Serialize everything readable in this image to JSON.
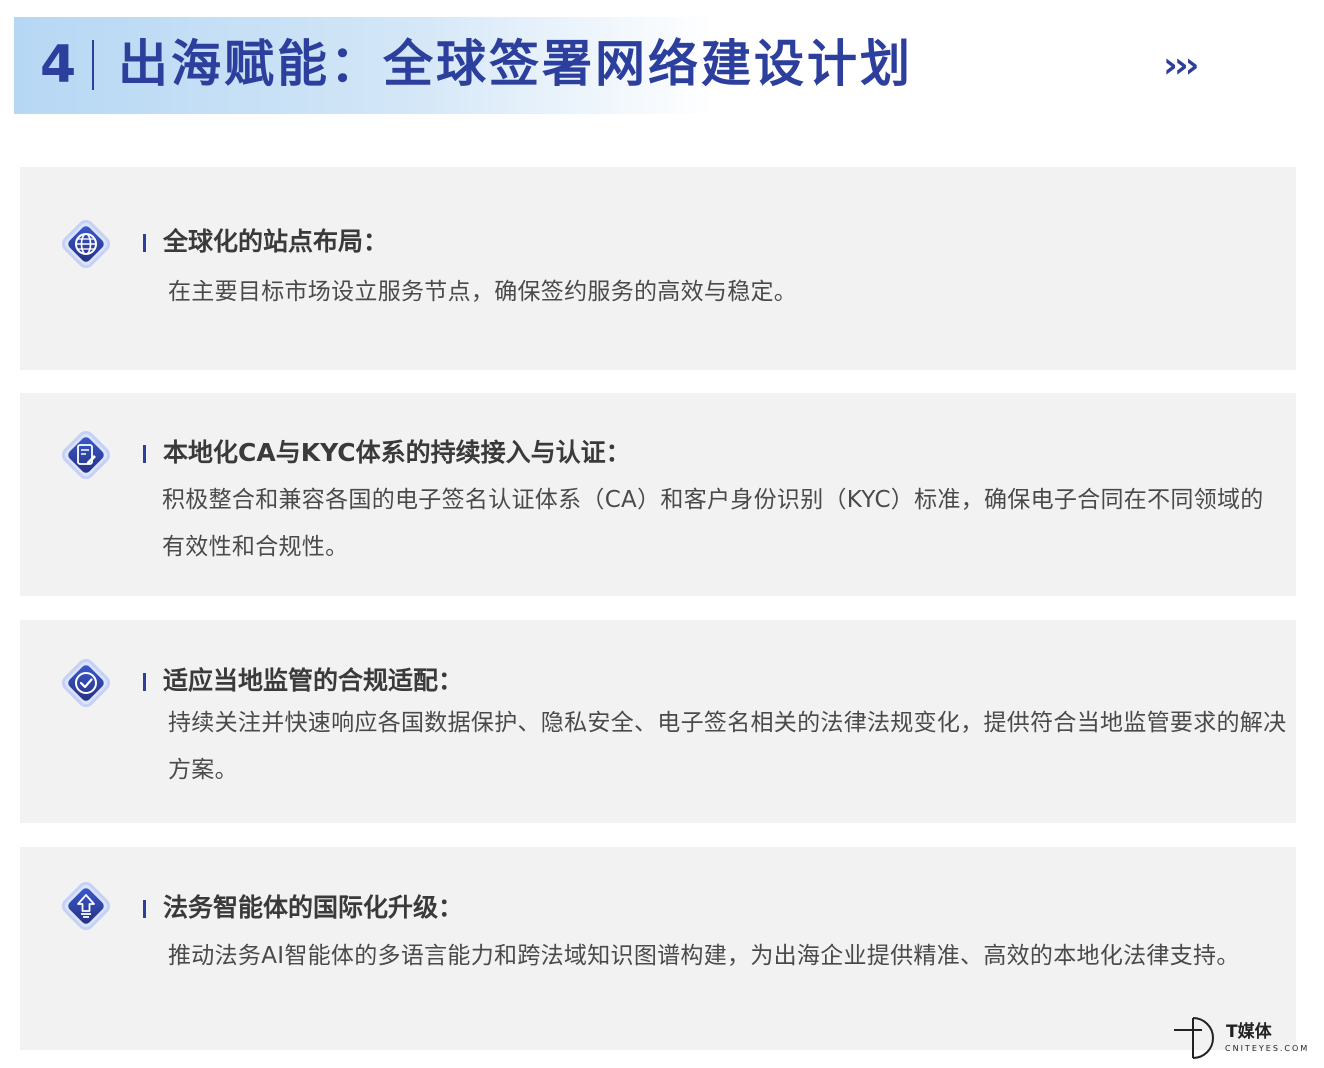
{
  "header": {
    "number": "4",
    "title": "出海赋能：全球签署网络建设计划",
    "arrows": "›››"
  },
  "cards": [
    {
      "icon": "globe-icon",
      "title": "全球化的站点布局：",
      "desc": "在主要目标市场设立服务节点，确保签约服务的高效与稳定。"
    },
    {
      "icon": "document-edit-icon",
      "title": "本地化CA与KYC体系的持续接入与认证：",
      "desc": "积极整合和兼容各国的电子签名认证体系（CA）和客户身份识别（KYC）标准，确保电子合同在不同领域的有效性和合规性。"
    },
    {
      "icon": "check-circle-icon",
      "title": "适应当地监管的合规适配：",
      "desc": "持续关注并快速响应各国数据保护、隐私安全、电子签名相关的法律法规变化，提供符合当地监管要求的解决方案。"
    },
    {
      "icon": "upgrade-arrow-icon",
      "title": "法务智能体的国际化升级：",
      "desc": "推动法务AI智能体的多语言能力和跨法域知识图谱构建，为出海企业提供精准、高效的本地化法律支持。"
    }
  ],
  "logo": {
    "name": "T媒体",
    "site": "CNITEYES.COM"
  },
  "colors": {
    "accent": "#2c3f9c",
    "card_bg": "#f2f2f2",
    "banner": "#c4def5"
  }
}
